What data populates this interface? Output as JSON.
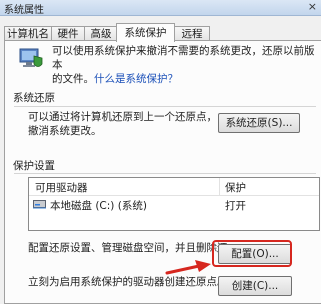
{
  "window": {
    "title": "系统属性",
    "close": "×"
  },
  "tabs": [
    {
      "label": "计算机名",
      "active": false
    },
    {
      "label": "硬件",
      "active": false
    },
    {
      "label": "高级",
      "active": false
    },
    {
      "label": "系统保护",
      "active": true
    },
    {
      "label": "远程",
      "active": false
    }
  ],
  "intro": {
    "line1": "可以使用系统保护来撤消不需要的系统更改，还原以前版本",
    "line2_prefix": "的文件。",
    "link": "什么是系统保护？"
  },
  "restore": {
    "group_title": "系统还原",
    "desc_line1": "可以通过将计算机还原到上一个还原点，",
    "desc_line2": "撤消系统更改。",
    "button_label": "系统还原(S)..."
  },
  "protection": {
    "group_title": "保护设置",
    "columns": [
      "可用驱动器",
      "保护"
    ],
    "rows": [
      {
        "drive": "本地磁盘 (C:) (系统)",
        "status": "打开"
      }
    ],
    "config_desc": "配置还原设置、管理磁盘空间，并且删除还",
    "config_button": "配置(O)...",
    "create_desc": "立刻为启用系统保护的驱动器创建还原点。",
    "create_button": "创建(C)..."
  },
  "colors": {
    "annotation": "#d6271f",
    "link": "#1a4fb8"
  }
}
